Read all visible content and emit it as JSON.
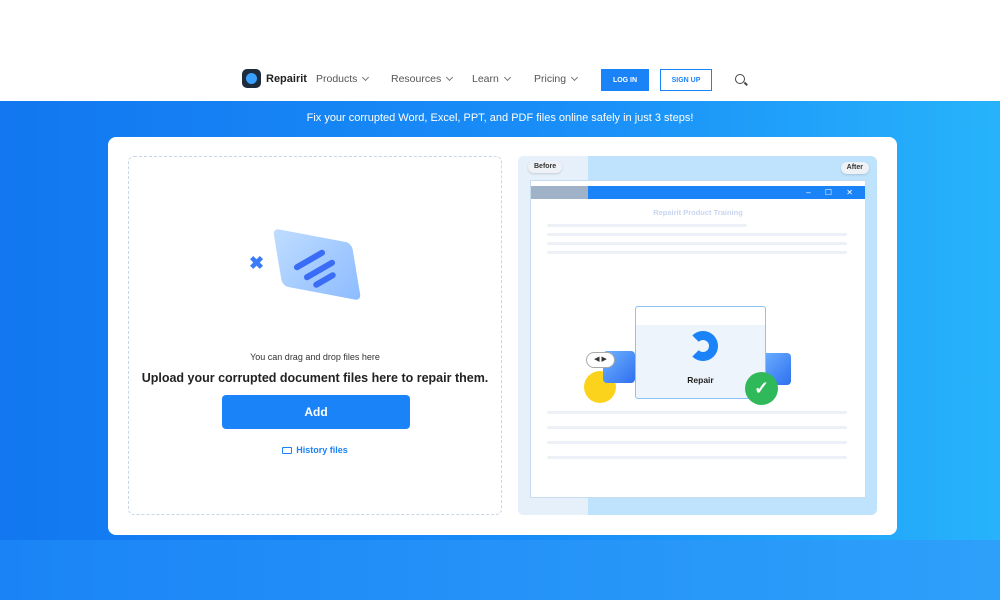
{
  "nav": {
    "brand": "Repairit",
    "items": [
      {
        "label": "Products"
      },
      {
        "label": "Resources"
      },
      {
        "label": "Learn"
      },
      {
        "label": "Pricing"
      }
    ],
    "login": "LOG IN",
    "signup": "SIGN UP"
  },
  "banner": "Fix your corrupted Word, Excel, PPT, and PDF files online safely in just 3 steps!",
  "upload": {
    "hint": "You can drag and drop files here",
    "headline": "Upload your corrupted document files here to repair them.",
    "add_label": "Add",
    "history_label": "History files"
  },
  "preview": {
    "before": "Before",
    "after": "After",
    "doc_title": "Repairit Product Training",
    "repair_label": "Repair",
    "window_controls": "– ☐ ✕"
  },
  "colors": {
    "accent": "#1a83f8",
    "success": "#2fb95a"
  }
}
